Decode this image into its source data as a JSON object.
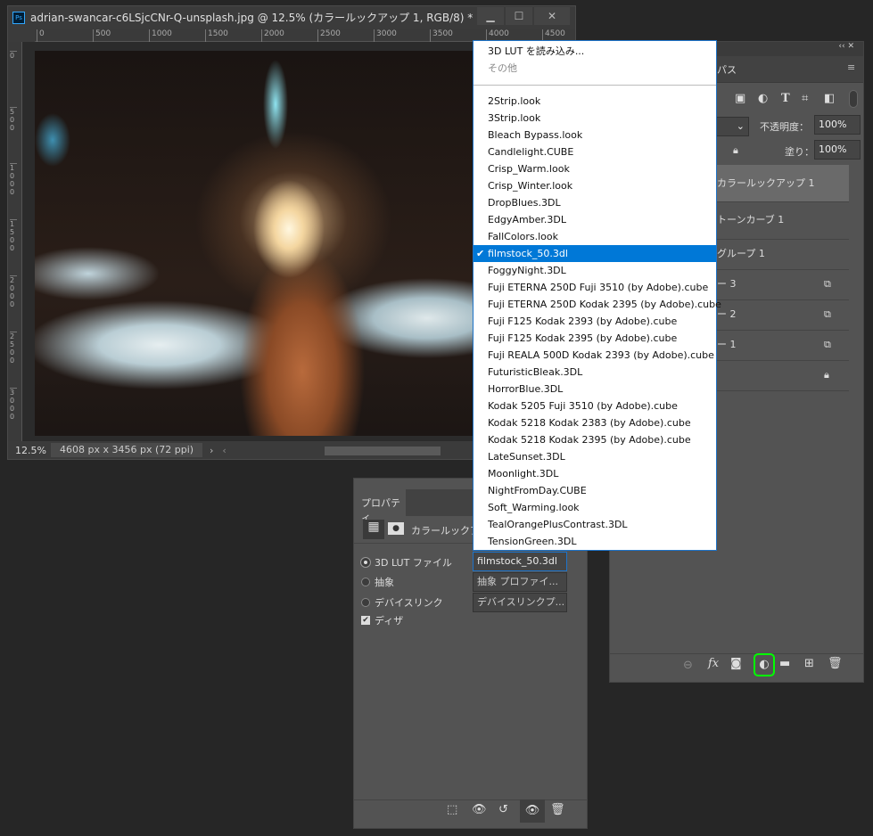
{
  "document": {
    "title": "adrian-swancar-c6LSjcCNr-Q-unsplash.jpg @ 12.5% (カラールックアップ 1, RGB/8) *",
    "app_icon": "Ps",
    "window_buttons": [
      "minimize-icon",
      "maximize-icon",
      "close-icon"
    ],
    "ruler_h": [
      "0",
      "500",
      "1000",
      "1500",
      "2000",
      "2500",
      "3000",
      "3500",
      "4000",
      "4500"
    ],
    "ruler_v": [
      "0",
      "500",
      "1000",
      "1500",
      "2000",
      "2500",
      "3000"
    ],
    "zoom": "12.5%",
    "info": "4608 px x 3456 px (72 ppi)"
  },
  "layers_panel": {
    "tab_partial": "パス",
    "opacity_label": "不透明度：",
    "opacity": "100%",
    "fill_label": "塗り：",
    "fill": "100%",
    "layers": [
      {
        "name": "カラールックアップ 1",
        "selected": true
      },
      {
        "name": "トーンカーブ 1"
      },
      {
        "name": "グループ 1"
      },
      {
        "name": "ー 3"
      },
      {
        "name": "ー 2"
      },
      {
        "name": "ー 1"
      },
      {
        "name": ""
      }
    ],
    "highlight_color": "#00ff00"
  },
  "properties": {
    "tab": "プロパティ",
    "title": "カラールックアップ",
    "options": [
      {
        "label": "3D LUT ファイル",
        "value": "filmstock_50.3dl",
        "selected": true
      },
      {
        "label": "抽象",
        "value": "抽象 プロファイ..."
      },
      {
        "label": "デバイスリンク",
        "value": "デバイスリンクプ..."
      }
    ],
    "dither_label": "ディザ",
    "dither_checked": true
  },
  "menu": {
    "load": "3D LUT を読み込み...",
    "other": "その他",
    "items": [
      "2Strip.look",
      "3Strip.look",
      "Bleach Bypass.look",
      "Candlelight.CUBE",
      "Crisp_Warm.look",
      "Crisp_Winter.look",
      "DropBlues.3DL",
      "EdgyAmber.3DL",
      "FallColors.look",
      "filmstock_50.3dl",
      "FoggyNight.3DL",
      "Fuji ETERNA 250D Fuji 3510 (by Adobe).cube",
      "Fuji ETERNA 250D Kodak 2395 (by Adobe).cube",
      "Fuji F125 Kodak 2393 (by Adobe).cube",
      "Fuji F125 Kodak 2395 (by Adobe).cube",
      "Fuji REALA 500D Kodak 2393 (by Adobe).cube",
      "FuturisticBleak.3DL",
      "HorrorBlue.3DL",
      "Kodak 5205 Fuji 3510 (by Adobe).cube",
      "Kodak 5218 Kodak 2383 (by Adobe).cube",
      "Kodak 5218 Kodak 2395 (by Adobe).cube",
      "LateSunset.3DL",
      "Moonlight.3DL",
      "NightFromDay.CUBE",
      "Soft_Warming.look",
      "TealOrangePlusContrast.3DL",
      "TensionGreen.3DL"
    ],
    "selected": "filmstock_50.3dl",
    "check": "✔",
    "accent": "#0078d7"
  }
}
